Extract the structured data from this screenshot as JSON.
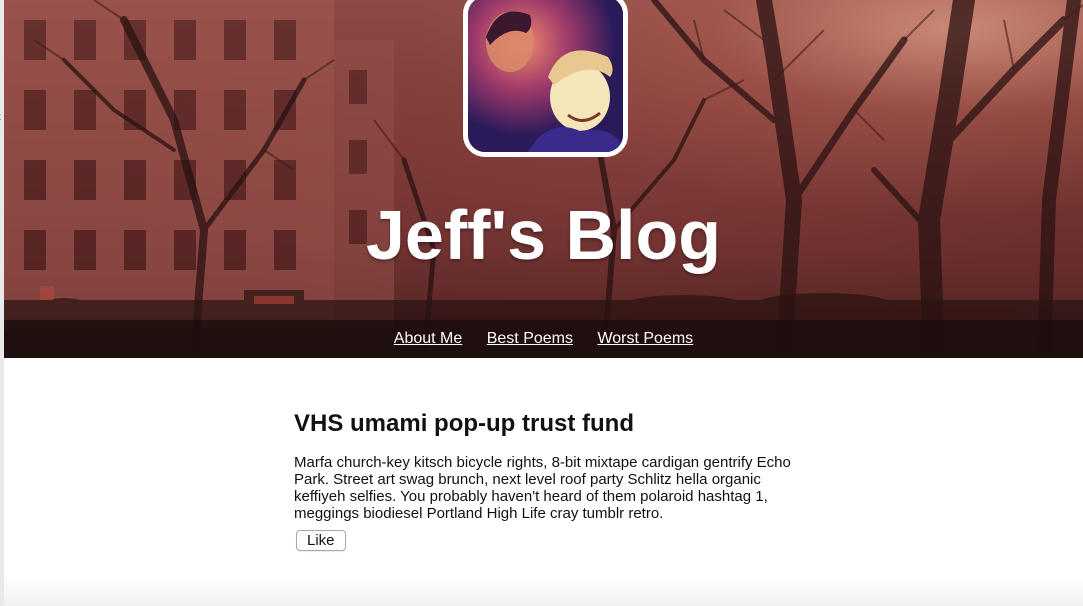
{
  "header": {
    "title": "Jeff's Blog",
    "colors": {
      "hero_tint": "#7a3a36",
      "nav_bar": "#190c0c",
      "title_text": "#ffffff"
    }
  },
  "nav": {
    "items": [
      {
        "label": "About Me"
      },
      {
        "label": "Best Poems"
      },
      {
        "label": "Worst Poems"
      }
    ]
  },
  "post": {
    "title": "VHS umami pop-up trust fund",
    "body": "Marfa church-key kitsch bicycle rights, 8-bit mixtape cardigan gentrify Echo Park. Street art swag brunch, next level roof party Schlitz hella organic keffiyeh selfies. You probably haven't heard of them polaroid hashtag 1, meggings biodiesel Portland High Life cray tumblr retro.",
    "like_label": "Like"
  }
}
